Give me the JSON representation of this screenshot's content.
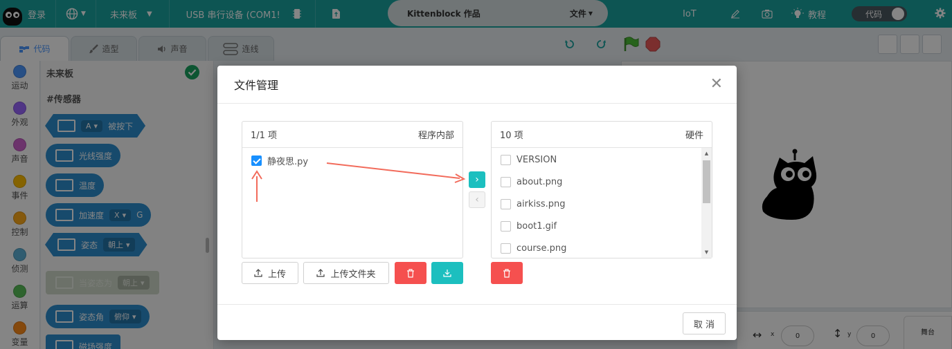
{
  "topbar": {
    "login": "登录",
    "board": "未来板",
    "device": "USB 串行设备 (COM1!",
    "project_title": "Kittenblock 作品",
    "file_menu": "文件",
    "iot": "IoT",
    "tutorial": "教程",
    "code_toggle": "代码"
  },
  "tabs": [
    {
      "label": "代码",
      "active": true
    },
    {
      "label": "造型",
      "active": false
    },
    {
      "label": "声音",
      "active": false
    },
    {
      "label": "连线",
      "active": false
    }
  ],
  "categories": [
    {
      "label": "运动",
      "color": "#4c97ff"
    },
    {
      "label": "外观",
      "color": "#9966ff"
    },
    {
      "label": "声音",
      "color": "#cf63cf"
    },
    {
      "label": "事件",
      "color": "#ffbf00"
    },
    {
      "label": "控制",
      "color": "#ffab19"
    },
    {
      "label": "侦测",
      "color": "#5cb1d6"
    },
    {
      "label": "运算",
      "color": "#59c059"
    },
    {
      "label": "变量",
      "color": "#ff8c1a"
    }
  ],
  "palette": {
    "board_label": "未来板",
    "section": "#传感器",
    "blocks": {
      "pressed": {
        "dropdown": "A",
        "text": "被按下"
      },
      "light": {
        "text": "光线强度"
      },
      "temp": {
        "text": "温度"
      },
      "accel": {
        "text": "加速度",
        "dropdown": "X",
        "suffix": "G"
      },
      "posture": {
        "text": "姿态",
        "dropdown": "朝上"
      },
      "when_posture": {
        "text": "当姿态为",
        "dropdown": "朝上"
      },
      "posture_angle": {
        "text": "姿态角",
        "dropdown": "俯仰"
      },
      "rotate_speed": {
        "text": "磁场强度"
      }
    }
  },
  "stage": {
    "x_label": "x",
    "x_value": "0",
    "y_label": "y",
    "y_value": "0",
    "stage_label": "舞台"
  },
  "modal": {
    "title": "文件管理",
    "left_panel": {
      "count": "1/1 项",
      "title": "程序内部",
      "files": [
        {
          "name": "静夜思.py",
          "checked": true
        }
      ]
    },
    "right_panel": {
      "count": "10 项",
      "title": "硬件",
      "files": [
        {
          "name": "VERSION",
          "checked": false
        },
        {
          "name": "about.png",
          "checked": false
        },
        {
          "name": "airkiss.png",
          "checked": false
        },
        {
          "name": "boot1.gif",
          "checked": false
        },
        {
          "name": "course.png",
          "checked": false
        }
      ]
    },
    "upload_label": "上传",
    "upload_folder_label": "上传文件夹",
    "cancel_label": "取 消"
  }
}
